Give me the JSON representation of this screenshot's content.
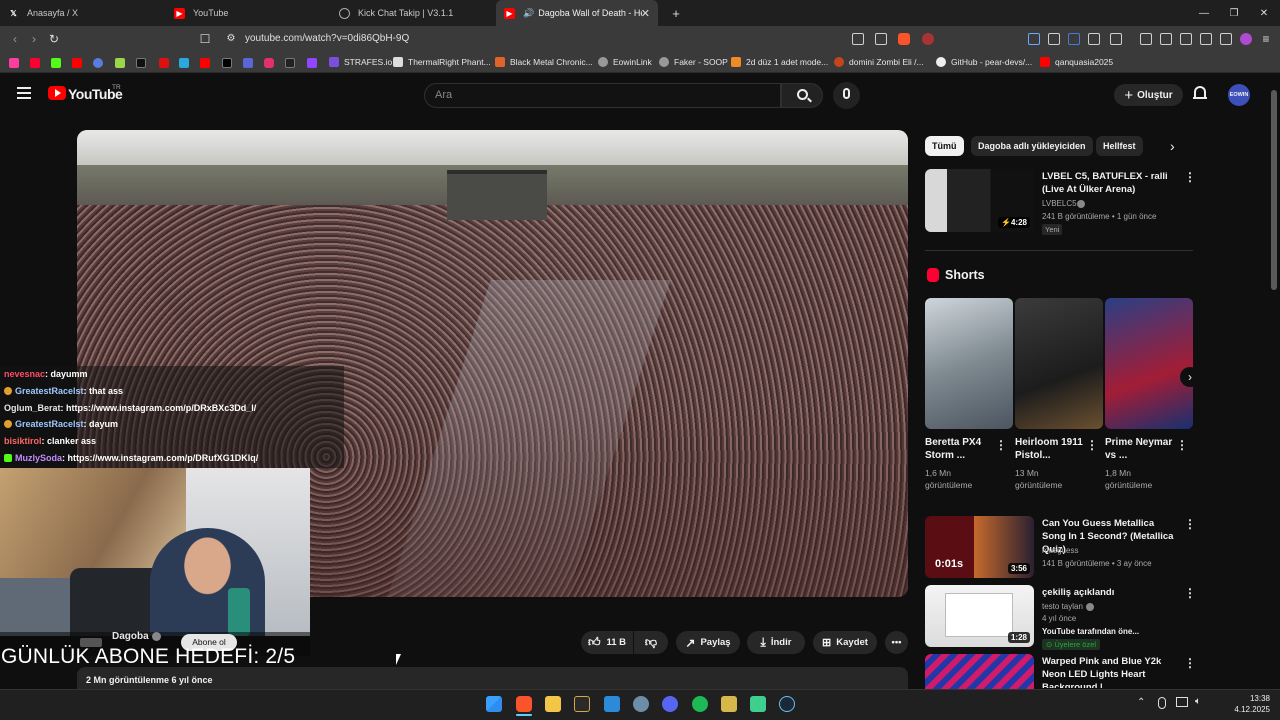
{
  "browser": {
    "tabs": [
      {
        "title": "Anasayfa / X",
        "icon": "x-logo-icon",
        "icon_color": "#000000"
      },
      {
        "title": "YouTube",
        "icon": "youtube-logo-icon",
        "icon_color": "#ff0000"
      },
      {
        "title": "Kick Chat Takip | V3.1.1",
        "icon": "globe-icon",
        "icon_color": "#888888"
      },
      {
        "title": "Dagoba Wall of Death - Hellf",
        "icon": "youtube-logo-icon",
        "icon_color": "#ff0000",
        "active": true
      }
    ],
    "url": "youtube.com/watch?v=0di86QbH-9Q",
    "bookmarks": [
      {
        "label": "STRAFES.io"
      },
      {
        "label": "ThermalRight Phant..."
      },
      {
        "label": "Black Metal Chronic..."
      },
      {
        "label": "EowinLink"
      },
      {
        "label": "Faker - SOOP"
      },
      {
        "label": "2d düz 1 adet mode..."
      },
      {
        "label": "domini Zombi Eli /..."
      },
      {
        "label": "GitHub - pear-devs/..."
      },
      {
        "label": "qanquasia2025"
      }
    ]
  },
  "youtube": {
    "logo_text": "YouTube",
    "logo_region": "TR",
    "search_placeholder": "Ara",
    "create_label": "Oluştur",
    "avatar_text": "EOWIN"
  },
  "overlay": {
    "chat": [
      {
        "user": "nevesnac",
        "message": ": dayumm",
        "color": "#ff4d6a",
        "badge": false
      },
      {
        "user": "GreatestRacelst",
        "message": ": that ass",
        "color": "#9fc7ff",
        "badge": true,
        "badge_color": "#e0a030"
      },
      {
        "user": "Oglum_Berat",
        "message": ": https://www.instagram.com/p/DRxBXc3Dd_l/",
        "color": "#e6e6e6",
        "badge": false
      },
      {
        "user": "GreatestRacelst",
        "message": ": dayum",
        "color": "#9fc7ff",
        "badge": true,
        "badge_color": "#e0a030"
      },
      {
        "user": "bisiktirol",
        "message": ": clanker ass",
        "color": "#ff6666",
        "badge": false
      },
      {
        "user": "MuzlySoda",
        "message": ": https://www.instagram.com/p/DRufXG1DKlq/",
        "color": "#c38cff",
        "badge": true,
        "badge_color": "#53fc18"
      }
    ],
    "channel_name": "Dagoba",
    "subscribe_label": "Abone ol",
    "goal_text": "GÜNLÜK ABONE HEDEFİ: 2/5"
  },
  "actions": {
    "like_count": "11 B",
    "share_label": "Paylaş",
    "download_label": "İndir",
    "save_label": "Kaydet"
  },
  "description": {
    "meta": "2 Mn görüntülenme  6 yıl önce"
  },
  "chips": [
    "Tümü",
    "Dagoba adlı yükleyiciden",
    "Hellfest"
  ],
  "related": [
    {
      "title": "LVBEL C5, BATUFLEX - ralli (Live At Ülker Arena)",
      "channel": "LVBELC5",
      "meta": "241 B görüntüleme • 1 gün önce",
      "badge": "Yeni",
      "duration": "4:28"
    }
  ],
  "shorts": {
    "header": "Shorts",
    "items": [
      {
        "title": "Beretta PX4 Storm ...",
        "views": "1,6 Mn görüntüleme"
      },
      {
        "title": "Heirloom 1911 Pistol...",
        "views": "13 Mn görüntüleme"
      },
      {
        "title": "Prime Neymar vs ...",
        "views": "1,8 Mn görüntüleme"
      }
    ]
  },
  "related_more": [
    {
      "title": "Can You Guess Metallica Song In 1 Second? (Metallica Quiz)",
      "channel": "musguess",
      "meta": "141 B görüntüleme • 3 ay önce",
      "duration": "3:56",
      "overlay": "0:01s"
    },
    {
      "title": "çekiliş açıklandı",
      "channel": "testo taylan",
      "meta": "4 yıl önce",
      "extra": "YouTube tarafından öne...",
      "badge": "Üyelere özel",
      "duration": "1:28"
    },
    {
      "title": "Warped Pink and Blue Y2k Neon LED Lights Heart Background |",
      "channel": "",
      "meta": ""
    }
  ],
  "taskbar": {
    "time": "13:38",
    "date": "4.12.2025"
  },
  "colors": {
    "accent_red": "#ff0000",
    "background": "#0f0f0f",
    "chip_bg": "#272727",
    "member_green": "#2ba640"
  }
}
